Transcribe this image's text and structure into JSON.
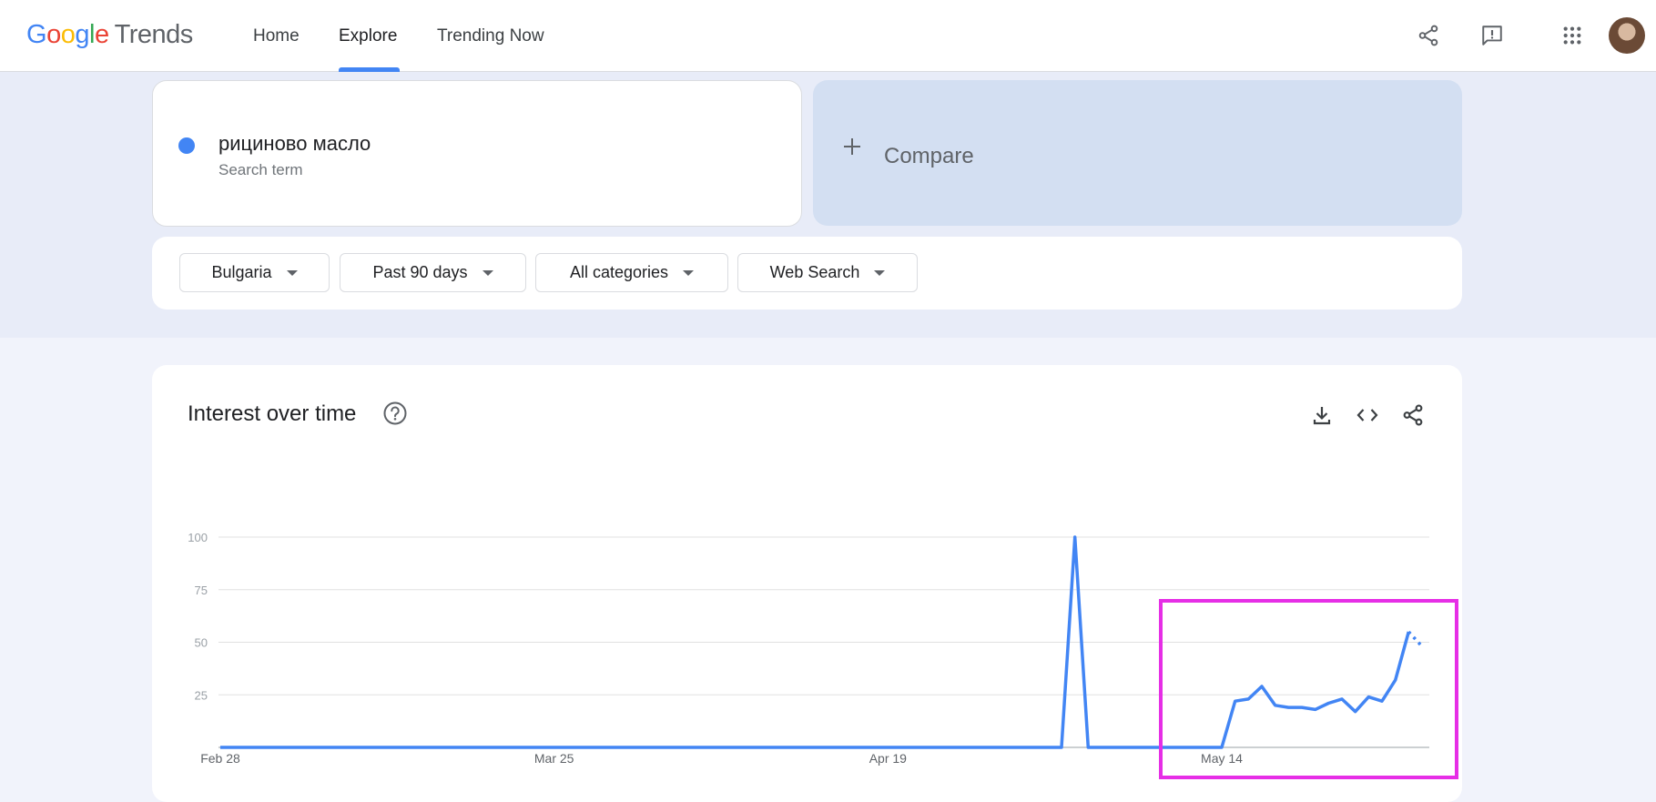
{
  "header": {
    "logo_google": "Google",
    "logo_trends": "Trends",
    "nav": {
      "home": "Home",
      "explore": "Explore",
      "trending": "Trending Now"
    }
  },
  "search": {
    "term": "рициново масло",
    "term_type": "Search term",
    "term_color": "#4285f4",
    "compare_label": "Compare"
  },
  "filters": {
    "region": "Bulgaria",
    "time": "Past 90 days",
    "category": "All categories",
    "property": "Web Search"
  },
  "chart_card": {
    "title": "Interest over time"
  },
  "chart_data": {
    "type": "line",
    "title": "Interest over time",
    "x_tick_labels": [
      "Feb 28",
      "Mar 25",
      "Apr 19",
      "May 14"
    ],
    "x_tick_index": [
      0,
      25,
      50,
      75
    ],
    "y_ticks": [
      25,
      50,
      75,
      100
    ],
    "ylim": [
      0,
      100
    ],
    "grid": true,
    "series": [
      {
        "name": "рициново масло",
        "color": "#4285f4",
        "x_index": [
          0,
          1,
          2,
          3,
          4,
          5,
          6,
          7,
          8,
          9,
          10,
          11,
          12,
          13,
          14,
          15,
          16,
          17,
          18,
          19,
          20,
          21,
          22,
          23,
          24,
          25,
          26,
          27,
          28,
          29,
          30,
          31,
          32,
          33,
          34,
          35,
          36,
          37,
          38,
          39,
          40,
          41,
          42,
          43,
          44,
          45,
          46,
          47,
          48,
          49,
          50,
          51,
          52,
          53,
          54,
          55,
          56,
          57,
          58,
          59,
          60,
          61,
          62,
          63,
          64,
          65,
          66,
          67,
          68,
          69,
          70,
          71,
          72,
          73,
          74,
          75,
          76,
          77,
          78,
          79,
          80,
          81,
          82,
          83,
          84,
          85,
          86,
          87,
          88,
          89,
          90
        ],
        "values": [
          0,
          0,
          0,
          0,
          0,
          0,
          0,
          0,
          0,
          0,
          0,
          0,
          0,
          0,
          0,
          0,
          0,
          0,
          0,
          0,
          0,
          0,
          0,
          0,
          0,
          0,
          0,
          0,
          0,
          0,
          0,
          0,
          0,
          0,
          0,
          0,
          0,
          0,
          0,
          0,
          0,
          0,
          0,
          0,
          0,
          0,
          0,
          0,
          0,
          0,
          0,
          0,
          0,
          0,
          0,
          0,
          0,
          0,
          0,
          0,
          0,
          0,
          0,
          0,
          100,
          0,
          0,
          0,
          0,
          0,
          0,
          0,
          0,
          0,
          0,
          0,
          22,
          23,
          29,
          20,
          19,
          19,
          18,
          21,
          23,
          17,
          24,
          22,
          32,
          55,
          48,
          37
        ],
        "partial_from_index": 89
      }
    ]
  }
}
